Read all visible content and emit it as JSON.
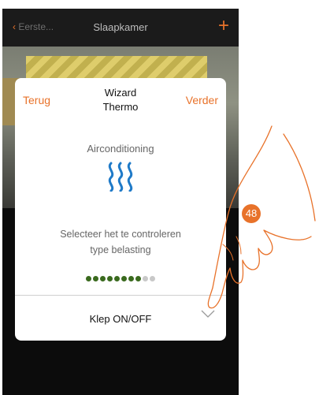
{
  "topbar": {
    "back_label": "Eerste...",
    "title": "Slaapkamer",
    "add_symbol": "+"
  },
  "dialog": {
    "back_label": "Terug",
    "next_label": "Verder",
    "title_line1": "Wizard",
    "title_line2": "Thermo",
    "subtitle": "Airconditioning",
    "icon": "heating-waves-icon",
    "prompt_line1": "Selecteer het te controleren",
    "prompt_line2": "type belasting",
    "progress": {
      "total_steps": 10,
      "completed_steps": 8
    },
    "selected_option": "Klep ON/OFF"
  },
  "annotation": {
    "step_number": "48"
  },
  "colors": {
    "accent": "#e8722a",
    "icon_blue": "#1f7ac8",
    "progress_done": "#3a6a1e",
    "progress_todo": "#c8c8c8"
  }
}
